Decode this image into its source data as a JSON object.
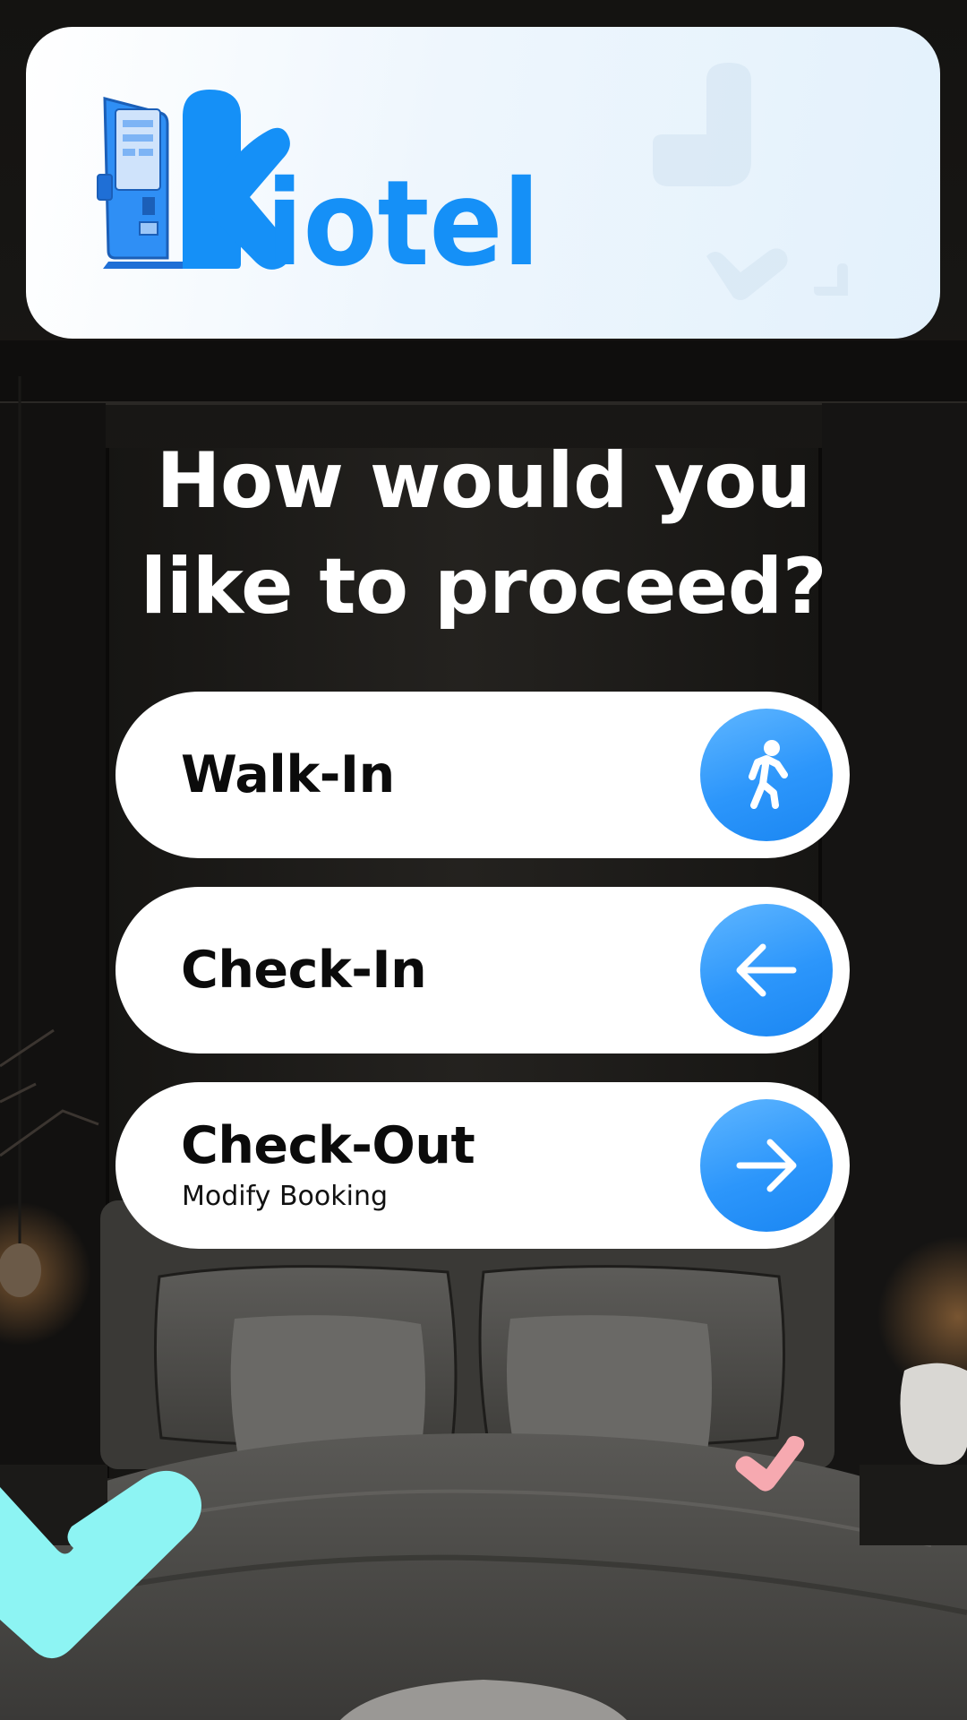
{
  "brand": {
    "logo_text": "Kiotel",
    "logo_color": "#1590f7"
  },
  "heading": {
    "line1": "How would you",
    "line2": "like to proceed?"
  },
  "options": [
    {
      "label": "Walk-In",
      "icon": "walking-person-icon"
    },
    {
      "label": "Check-In",
      "icon": "arrow-left-icon"
    },
    {
      "label": "Check-Out",
      "sublabel": "Modify Booking",
      "icon": "arrow-right-icon"
    }
  ],
  "colors": {
    "accent": "#2c96fb",
    "deco_cyan": "#8df4f3",
    "deco_pink": "#f6a9b0"
  }
}
